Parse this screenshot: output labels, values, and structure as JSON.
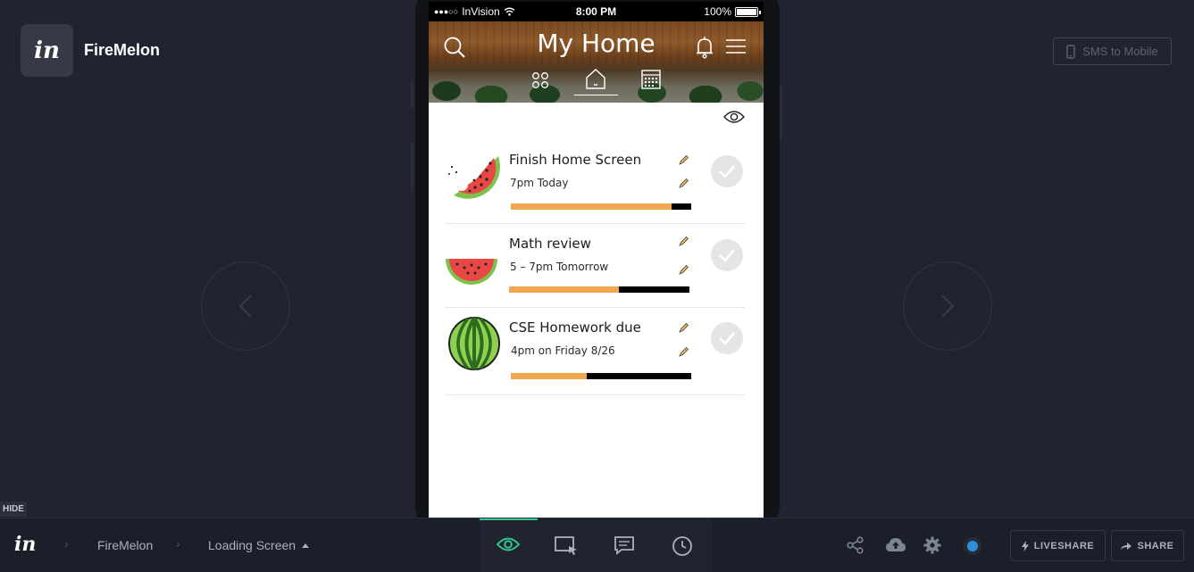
{
  "project": {
    "logo_text": "in",
    "name": "FireMelon"
  },
  "sms_button": {
    "label": "SMS to Mobile",
    "icon": "mobile-icon"
  },
  "status_bar": {
    "carrier": "InVision",
    "time": "8:00 PM",
    "battery": "100%"
  },
  "app": {
    "title": "My Home",
    "header_icons": [
      "search-icon",
      "bell-icon",
      "menu-icon"
    ],
    "tabs": [
      "apps-icon",
      "home-icon",
      "calendar-icon"
    ],
    "active_tab": "home-icon"
  },
  "tasks": [
    {
      "title": "Finish Home Screen",
      "time": "7pm Today",
      "progress": 0.89,
      "icon": "watermelon-slice-bitten-icon"
    },
    {
      "title": "Math review",
      "time": "5 – 7pm Tomorrow",
      "progress": 0.61,
      "icon": "watermelon-half-icon"
    },
    {
      "title": "CSE Homework due",
      "time": "4pm on Friday 8/26",
      "progress": 0.42,
      "icon": "watermelon-whole-icon"
    }
  ],
  "bottom_bar": {
    "hide_label": "HIDE",
    "logo_text": "in",
    "breadcrumb": [
      "FireMelon",
      "Loading Screen"
    ],
    "tools": [
      "preview-eye-icon",
      "inspect-icon",
      "comment-icon",
      "history-icon"
    ],
    "active_tool": "preview-eye-icon",
    "right_icons": [
      "share-icon",
      "cloud-upload-icon",
      "settings-icon",
      "status-dot-icon"
    ],
    "liveshare_label": "LIVESHARE",
    "share_label": "SHARE"
  },
  "colors": {
    "background": "#202431",
    "progress": "#f2a650",
    "accent": "#33c58a",
    "status_dot": "#2f8fd6"
  }
}
